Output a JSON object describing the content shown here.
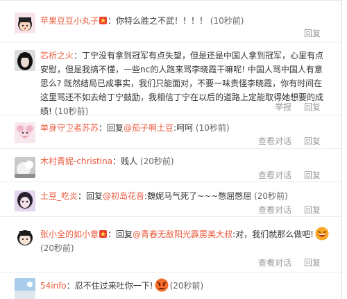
{
  "comments": [
    {
      "user": "苹果豆豆小丸子",
      "body": "：你特么胜之不武！！！！",
      "time": "(10秒前)",
      "reply": "回复"
    },
    {
      "user": "芯析之火",
      "body": "：丁宁没有拿到冠军有点失望，但是还是中国人拿到冠军，心里有点安慰，但是我搞不懂，一些nc的人跑来骂李晓霞干嘛呢! 中国人骂中国人有意思么? 既然结局已成事实，我们只能面对，不要一味责怪李晓霞，你有时间在这里骂还不如去给丁宁鼓励，我相信丁宁在以后的道路上定能取得她想要的成绩!",
      "time": "(10秒前)",
      "report": "举报",
      "reply": "回复"
    },
    {
      "user": "单身守卫者苏苏",
      "prefix": "：回复",
      "mention": "@茄子啊土豆",
      "body": ":呵呵",
      "time": "(10秒前)",
      "view": "查看对话",
      "reply": "回复"
    },
    {
      "user": "木村青妮-christina",
      "body": "：贱人",
      "time": "(20秒前)",
      "view": "查看对话",
      "reply": "回复"
    },
    {
      "user": "土豆_吃炎",
      "prefix": "：回复",
      "mention": "@初岛花音",
      "body": ":魏妮马气死了~~~憋屈憋屈",
      "time": "(20秒前)",
      "view": "查看对话",
      "reply": "回复"
    },
    {
      "user": "张小全的如小意",
      "prefix": "：回复",
      "mention": "@青春无敌阳光霹雳美大叔",
      "body": ":对，我们就那么做吧!",
      "time": "(20秒前)",
      "view": "查看对话",
      "reply": "回复"
    },
    {
      "user": "54info",
      "body": "：忍不住过来吐你一下!",
      "time": "(20秒前)"
    }
  ],
  "colors": {
    "user_link": "#eb5a3c",
    "action_text": "#9a9a9a",
    "divider": "#eeeeee"
  }
}
